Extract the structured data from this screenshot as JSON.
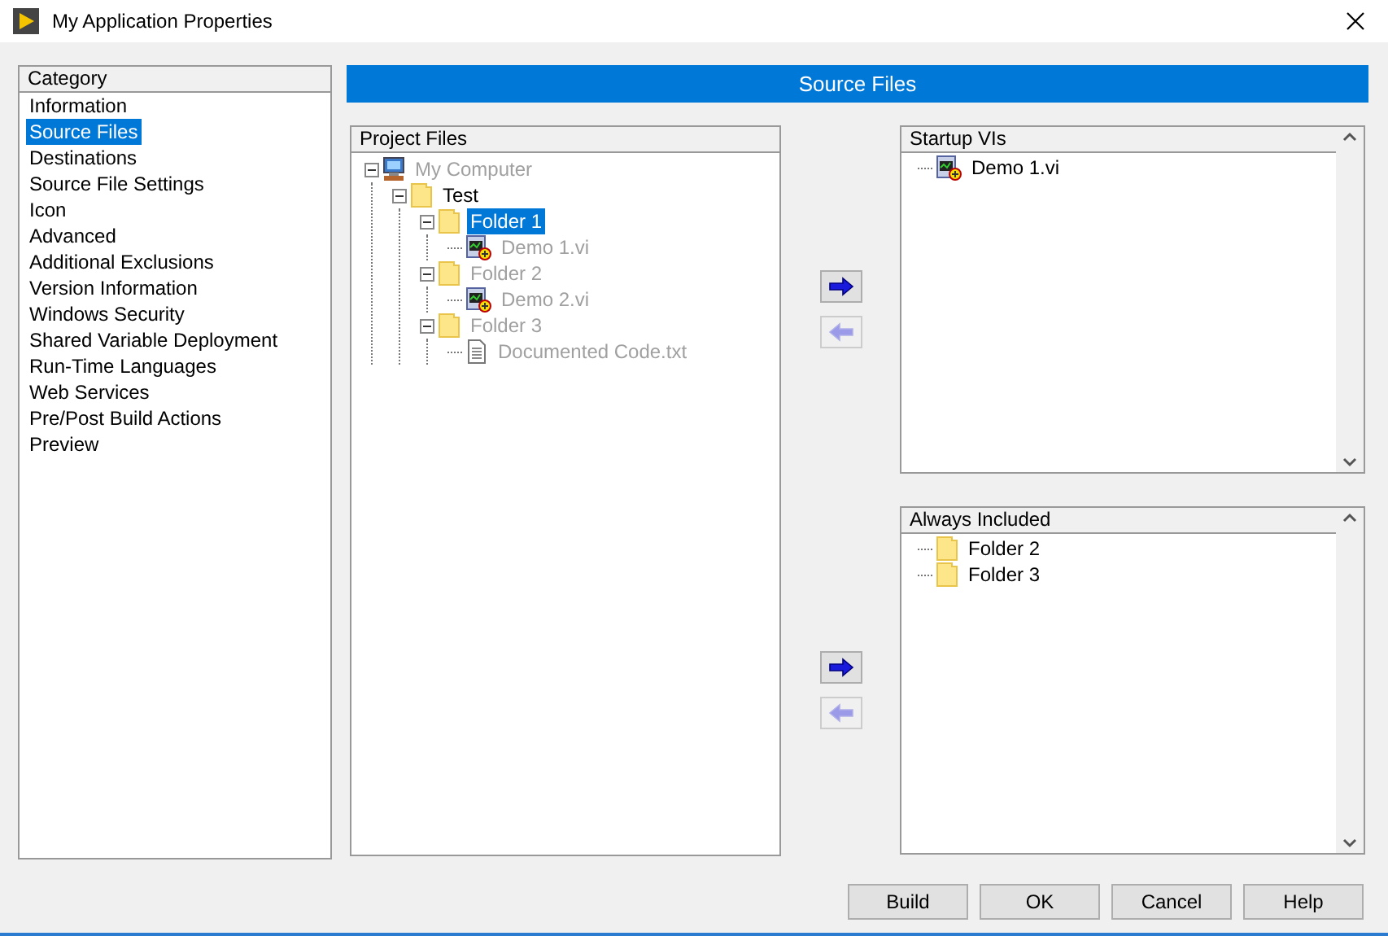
{
  "window": {
    "title": "My Application Properties"
  },
  "category": {
    "heading": "Category",
    "items": [
      {
        "label": "Information",
        "selected": false
      },
      {
        "label": "Source Files",
        "selected": true
      },
      {
        "label": "Destinations",
        "selected": false
      },
      {
        "label": "Source File Settings",
        "selected": false
      },
      {
        "label": "Icon",
        "selected": false
      },
      {
        "label": "Advanced",
        "selected": false
      },
      {
        "label": "Additional Exclusions",
        "selected": false
      },
      {
        "label": "Version Information",
        "selected": false
      },
      {
        "label": "Windows Security",
        "selected": false
      },
      {
        "label": "Shared Variable Deployment",
        "selected": false
      },
      {
        "label": "Run-Time Languages",
        "selected": false
      },
      {
        "label": "Web Services",
        "selected": false
      },
      {
        "label": "Pre/Post Build Actions",
        "selected": false
      },
      {
        "label": "Preview",
        "selected": false
      }
    ]
  },
  "page_title": "Source Files",
  "project_files": {
    "heading": "Project Files",
    "tree": [
      {
        "kind": "computer",
        "label": "My Computer",
        "disabled": true,
        "selected": false,
        "expanded": true,
        "children": [
          {
            "kind": "folder",
            "label": "Test",
            "disabled": false,
            "selected": false,
            "expanded": true,
            "children": [
              {
                "kind": "folder",
                "label": "Folder 1",
                "disabled": false,
                "selected": true,
                "expanded": true,
                "children": [
                  {
                    "kind": "vi",
                    "label": "Demo 1.vi",
                    "disabled": true,
                    "selected": false
                  }
                ]
              },
              {
                "kind": "folder",
                "label": "Folder 2",
                "disabled": true,
                "selected": false,
                "expanded": true,
                "children": [
                  {
                    "kind": "vi",
                    "label": "Demo 2.vi",
                    "disabled": true,
                    "selected": false
                  }
                ]
              },
              {
                "kind": "folder",
                "label": "Folder 3",
                "disabled": true,
                "selected": false,
                "expanded": true,
                "children": [
                  {
                    "kind": "text",
                    "label": "Documented Code.txt",
                    "disabled": true,
                    "selected": false
                  }
                ]
              }
            ]
          }
        ]
      }
    ]
  },
  "transfers": [
    {
      "add_disabled": false,
      "remove_disabled": true,
      "list": {
        "heading": "Startup VIs",
        "items": [
          {
            "kind": "vi",
            "label": "Demo 1.vi"
          }
        ]
      }
    },
    {
      "add_disabled": false,
      "remove_disabled": true,
      "list": {
        "heading": "Always Included",
        "items": [
          {
            "kind": "folder",
            "label": "Folder 2"
          },
          {
            "kind": "folder",
            "label": "Folder 3"
          }
        ]
      }
    }
  ],
  "buttons": [
    "Build",
    "OK",
    "Cancel",
    "Help"
  ]
}
